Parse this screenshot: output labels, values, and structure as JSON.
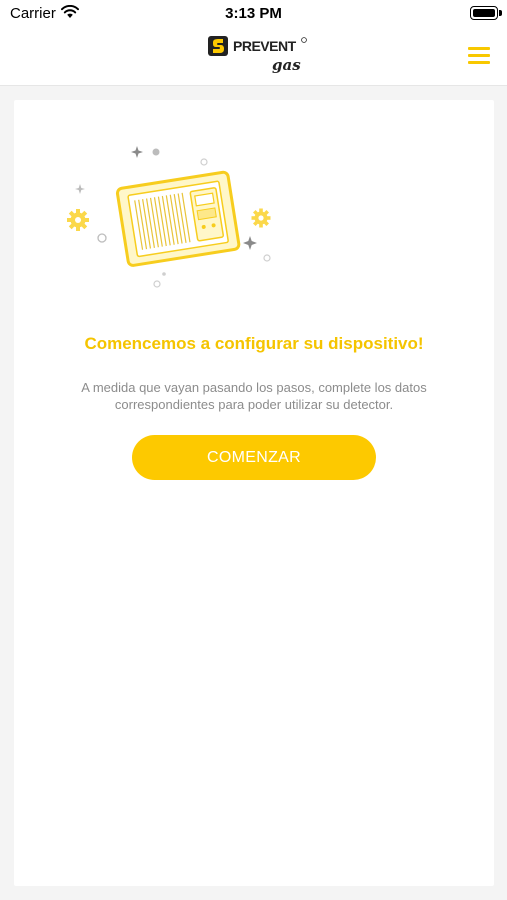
{
  "status_bar": {
    "carrier": "Carrier",
    "time": "3:13 PM"
  },
  "header": {
    "logo_text": "PREVENT",
    "logo_script": "gas",
    "menu_icon": "hamburger-menu-icon"
  },
  "main": {
    "illustration_icon": "gas-detector-device-icon",
    "title": "Comencemos a configurar su dispositivo!",
    "description": "A medida que vayan pasando los pasos, complete los datos correspondientes para poder utilizar su detector.",
    "start_button_label": "COMENZAR"
  },
  "colors": {
    "accent": "#fdc900",
    "title": "#f5c400",
    "text_muted": "#8c8c8c"
  }
}
